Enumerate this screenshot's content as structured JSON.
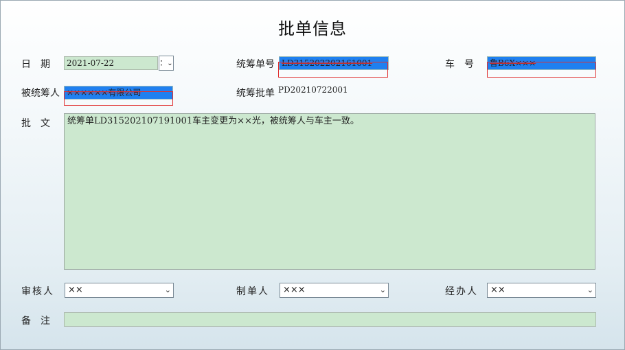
{
  "title": "批单信息",
  "date": {
    "label": "日　期",
    "value": "2021-07-22",
    "button": "：",
    "chevron": "⌄"
  },
  "pool_no": {
    "label": "统筹单号",
    "value": "LD315202202161001"
  },
  "plate": {
    "label": "车　号",
    "value": "鲁B6X×××"
  },
  "insured": {
    "label": "被统筹人",
    "value": "××××××有限公司"
  },
  "endorsement_no": {
    "label": "统筹批单",
    "value": "PD20210722001"
  },
  "text": {
    "label": "批　文",
    "value": "统筹单LD315202107191001车主变更为××光，被统筹人与车主一致。"
  },
  "reviewer": {
    "label": "审核人",
    "value": "××"
  },
  "maker": {
    "label": "制单人",
    "value": "×××"
  },
  "handler": {
    "label": "经办人",
    "value": "××"
  },
  "remark": {
    "label": "备　注",
    "value": ""
  },
  "icons": {
    "dropdown": "⌄"
  },
  "colors": {
    "field_green": "#cce8cf",
    "selection_blue": "#1f80f0",
    "highlight_red": "#e03030"
  }
}
